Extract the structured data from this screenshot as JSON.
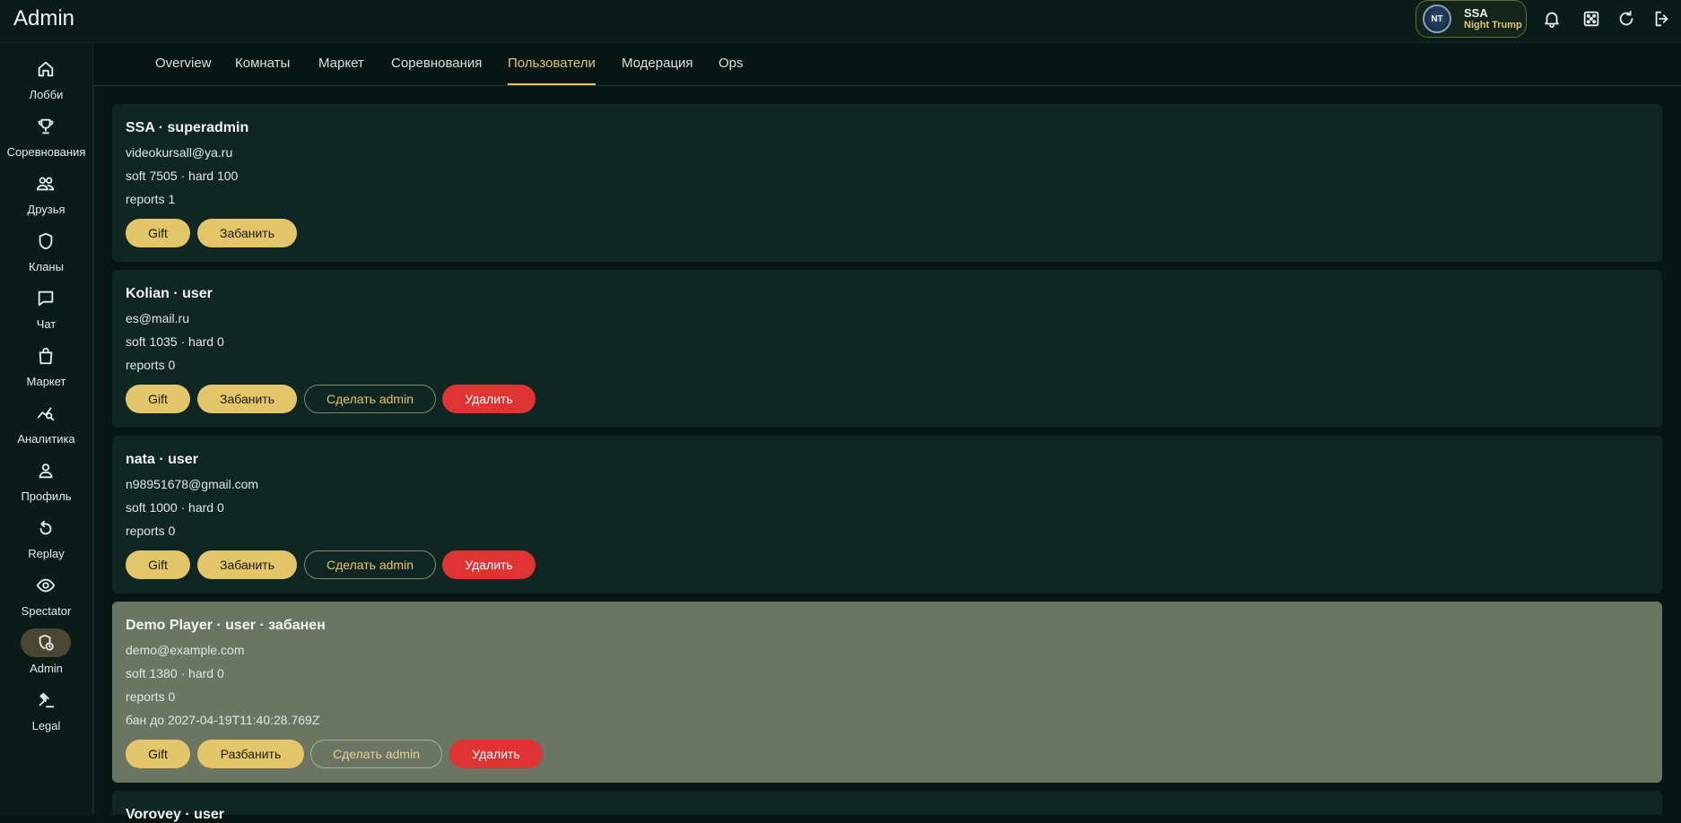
{
  "app": {
    "title": "Admin"
  },
  "profile": {
    "avatar_initials": "NT",
    "name": "SSA",
    "subtitle": "Night Trump"
  },
  "topbar_icons": [
    "bell-icon",
    "dice-icon",
    "refresh-icon",
    "logout-icon"
  ],
  "sidebar": {
    "items": [
      {
        "label": "Лобби",
        "icon": "home-icon"
      },
      {
        "label": "Соревнования",
        "icon": "trophy-icon"
      },
      {
        "label": "Друзья",
        "icon": "friends-icon"
      },
      {
        "label": "Кланы",
        "icon": "shield-icon"
      },
      {
        "label": "Чат",
        "icon": "chat-icon"
      },
      {
        "label": "Маркет",
        "icon": "bag-icon"
      },
      {
        "label": "Аналитика",
        "icon": "analytics-icon"
      },
      {
        "label": "Профиль",
        "icon": "person-icon"
      },
      {
        "label": "Replay",
        "icon": "replay-icon"
      },
      {
        "label": "Spectator",
        "icon": "eye-icon"
      },
      {
        "label": "Admin",
        "icon": "admin-icon",
        "active": true
      },
      {
        "label": "Legal",
        "icon": "gavel-icon"
      }
    ]
  },
  "tabs": [
    {
      "label": "Overview"
    },
    {
      "label": "Комнаты"
    },
    {
      "label": "Маркет"
    },
    {
      "label": "Соревнования"
    },
    {
      "label": "Пользователи",
      "active": true
    },
    {
      "label": "Модерация"
    },
    {
      "label": "Ops"
    }
  ],
  "users": [
    {
      "title": "SSA · superadmin",
      "email": "videokursall@ya.ru",
      "balance": "soft 7505 · hard 100",
      "reports": "reports 1",
      "buttons": {
        "gift": "Gift",
        "ban": "Забанить"
      }
    },
    {
      "title": "Kolian · user",
      "email": "es@mail.ru",
      "balance": "soft 1035 · hard 0",
      "reports": "reports 0",
      "buttons": {
        "gift": "Gift",
        "ban": "Забанить",
        "make_admin": "Сделать admin",
        "delete": "Удалить"
      }
    },
    {
      "title": "nata · user",
      "email": "n98951678@gmail.com",
      "balance": "soft 1000 · hard 0",
      "reports": "reports 0",
      "buttons": {
        "gift": "Gift",
        "ban": "Забанить",
        "make_admin": "Сделать admin",
        "delete": "Удалить"
      }
    },
    {
      "title": "Demo Player · user · забанен",
      "email": "demo@example.com",
      "balance": "soft 1380 · hard 0",
      "reports": "reports 0",
      "ban_until": "бан до 2027-04-19T11:40:28.769Z",
      "buttons": {
        "gift": "Gift",
        "unban": "Разбанить",
        "make_admin": "Сделать admin",
        "delete": "Удалить"
      }
    },
    {
      "title": "Vorovey · user"
    }
  ],
  "colors": {
    "accent": "#e3c56a",
    "danger": "#e03434",
    "card_bg": "#0f2622",
    "banned_card_bg": "#6a7563",
    "page_bg": "#071613"
  }
}
